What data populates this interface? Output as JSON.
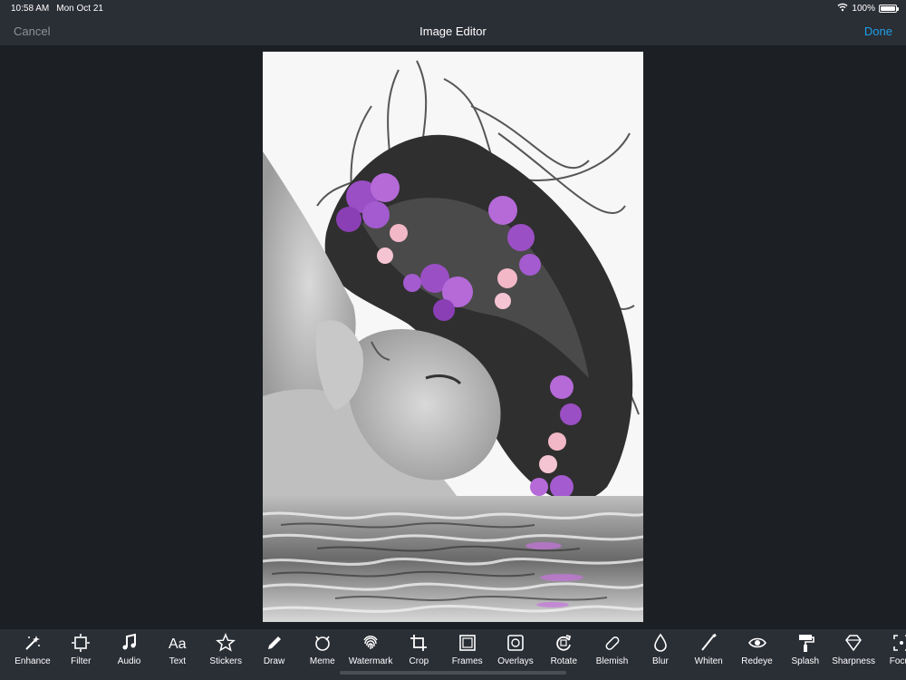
{
  "status_bar": {
    "time": "10:58 AM",
    "date": "Mon Oct 21",
    "battery": "100%",
    "battery_level": 1.0,
    "icons": [
      "wifi-icon",
      "battery-icon"
    ]
  },
  "nav": {
    "cancel_label": "Cancel",
    "title": "Image Editor",
    "done_label": "Done"
  },
  "colors": {
    "background": "#1c1f24",
    "bar": "#2a2e35",
    "accent": "#1ea0e8",
    "cancel_text": "#8e9399"
  },
  "canvas": {
    "image_subject": "black and white portrait of a woman with flowing hair and purple flowers, water reflection"
  },
  "toolbar": {
    "tools": [
      {
        "label": "Enhance",
        "icon": "magic-wand-icon"
      },
      {
        "label": "Filter",
        "icon": "filter-icon"
      },
      {
        "label": "Audio",
        "icon": "music-note-icon"
      },
      {
        "label": "Text",
        "icon": "text-aa-icon"
      },
      {
        "label": "Stickers",
        "icon": "star-icon"
      },
      {
        "label": "Draw",
        "icon": "pencil-icon"
      },
      {
        "label": "Meme",
        "icon": "meme-face-icon"
      },
      {
        "label": "Watermark",
        "icon": "fingerprint-icon"
      },
      {
        "label": "Crop",
        "icon": "crop-icon"
      },
      {
        "label": "Frames",
        "icon": "frame-icon"
      },
      {
        "label": "Overlays",
        "icon": "overlay-icon"
      },
      {
        "label": "Rotate",
        "icon": "rotate-icon"
      },
      {
        "label": "Blemish",
        "icon": "bandage-icon"
      },
      {
        "label": "Blur",
        "icon": "droplet-icon"
      },
      {
        "label": "Whiten",
        "icon": "brush-icon"
      },
      {
        "label": "Redeye",
        "icon": "eye-icon"
      },
      {
        "label": "Splash",
        "icon": "paint-roller-icon"
      },
      {
        "label": "Sharpness",
        "icon": "diamond-icon"
      },
      {
        "label": "Focus",
        "icon": "focus-icon"
      }
    ]
  }
}
